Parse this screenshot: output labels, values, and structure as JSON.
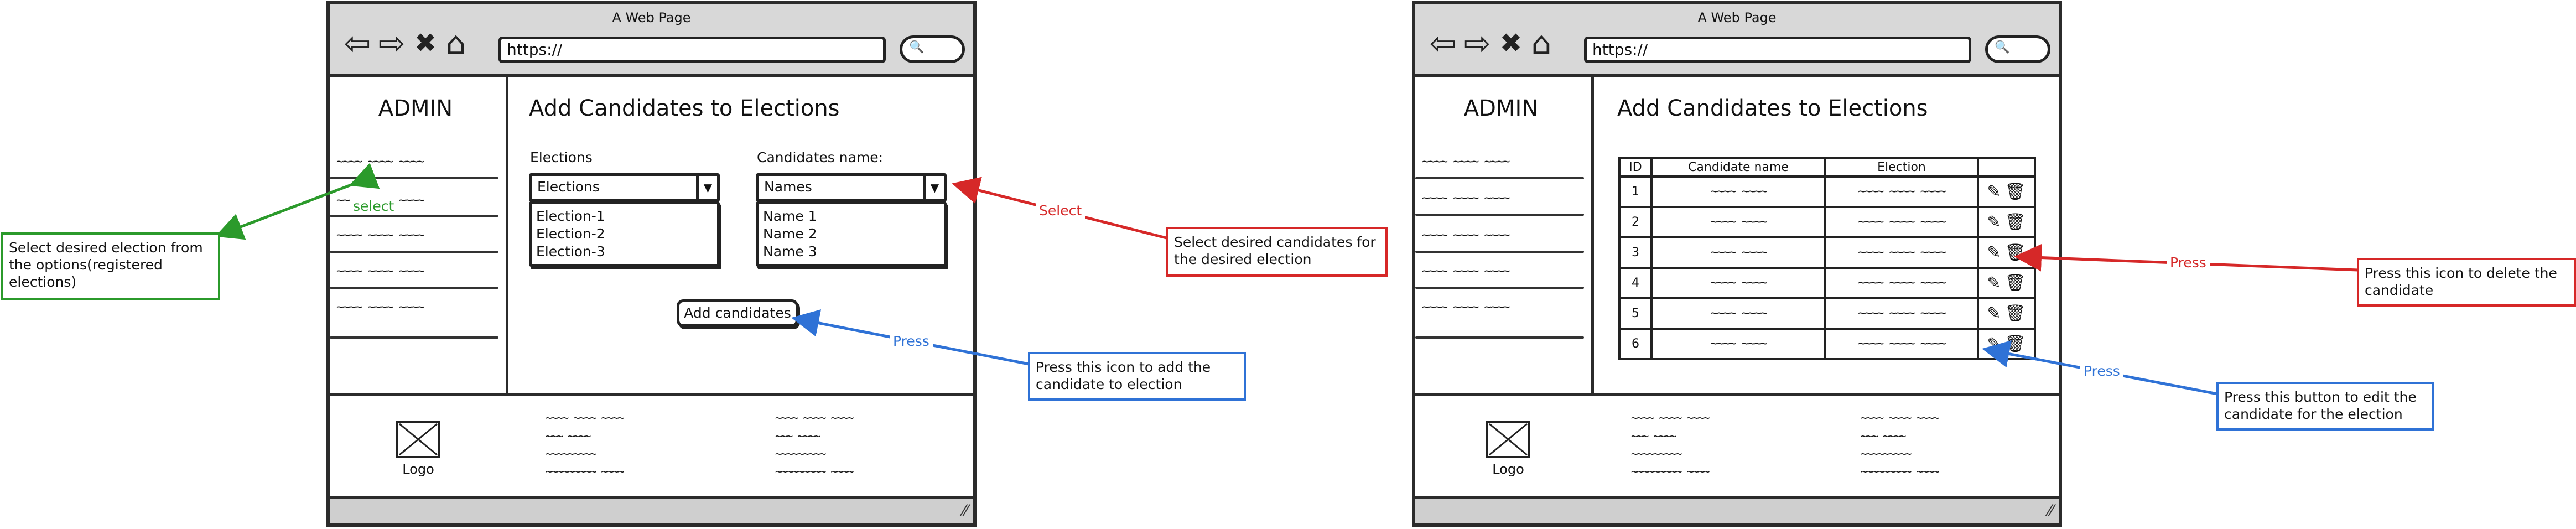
{
  "mockups": [
    {
      "title": "A Web Page",
      "url": "https://",
      "sidebar": {
        "heading": "ADMIN",
        "item_scribble": "~~~~ ~~~~ ~~~~"
      },
      "main": {
        "title": "Add Candidates to Elections",
        "elections_label": "Elections",
        "elections_selected": "Elections",
        "elections_options": [
          "Election-1",
          "Election-2",
          "Election-3"
        ],
        "candidates_label": "Candidates name:",
        "candidates_selected": "Names",
        "candidates_options": [
          "Name 1",
          "Name 2",
          "Name 3"
        ],
        "add_button": "Add candidates"
      },
      "footer": {
        "logo_label": "Logo",
        "col_lines": [
          "~~~~ ~~~~ ~~~~",
          "~~~ ~~~~",
          "~~~~~~~~~",
          "~~~~~~~~~ ~~~~"
        ]
      }
    },
    {
      "title": "A Web Page",
      "url": "https://",
      "sidebar": {
        "heading": "ADMIN",
        "item_scribble": "~~~~ ~~~~ ~~~~"
      },
      "main": {
        "title": "Add Candidates to Elections",
        "table": {
          "headers": [
            "ID",
            "Candidate name",
            "Election",
            ""
          ],
          "rows": [
            {
              "id": "1",
              "name": "~~~~ ~~~~",
              "election": "~~~~ ~~~~ ~~~~"
            },
            {
              "id": "2",
              "name": "~~~~ ~~~~",
              "election": "~~~~ ~~~~ ~~~~"
            },
            {
              "id": "3",
              "name": "~~~~ ~~~~",
              "election": "~~~~ ~~~~ ~~~~"
            },
            {
              "id": "4",
              "name": "~~~~ ~~~~",
              "election": "~~~~ ~~~~ ~~~~"
            },
            {
              "id": "5",
              "name": "~~~~ ~~~~",
              "election": "~~~~ ~~~~ ~~~~"
            },
            {
              "id": "6",
              "name": "~~~~ ~~~~",
              "election": "~~~~ ~~~~ ~~~~"
            }
          ]
        }
      },
      "footer": {
        "logo_label": "Logo",
        "col_lines": [
          "~~~~ ~~~~ ~~~~",
          "~~~ ~~~~",
          "~~~~~~~~~",
          "~~~~~~~~~ ~~~~"
        ]
      }
    }
  ],
  "annotations": {
    "select_election_note": "Select desired election from the options(registered elections)",
    "select_election_tag": "select",
    "select_candidates_note": "Select desired candidates for the desired election",
    "select_candidates_tag": "Select",
    "add_note": "Press this icon to add the candidate to election",
    "add_tag": "Press",
    "delete_note": "Press this icon to delete the candidate",
    "delete_tag": "Press",
    "edit_note": "Press this button to edit the candidate for the election",
    "edit_tag": "Press"
  },
  "icons": {
    "back": "back-arrow-icon",
    "forward": "forward-arrow-icon",
    "stop": "close-icon",
    "home": "home-icon",
    "search": "search-icon",
    "edit": "edit-icon",
    "delete": "trash-icon",
    "logo": "image-placeholder-icon",
    "resize": "resize-grip-icon"
  },
  "colors": {
    "green": "#2b9a2b",
    "red": "#d62828",
    "blue": "#2f72d6",
    "chrome_gray": "#d8d8d8",
    "frame": "#2b2b2b"
  }
}
